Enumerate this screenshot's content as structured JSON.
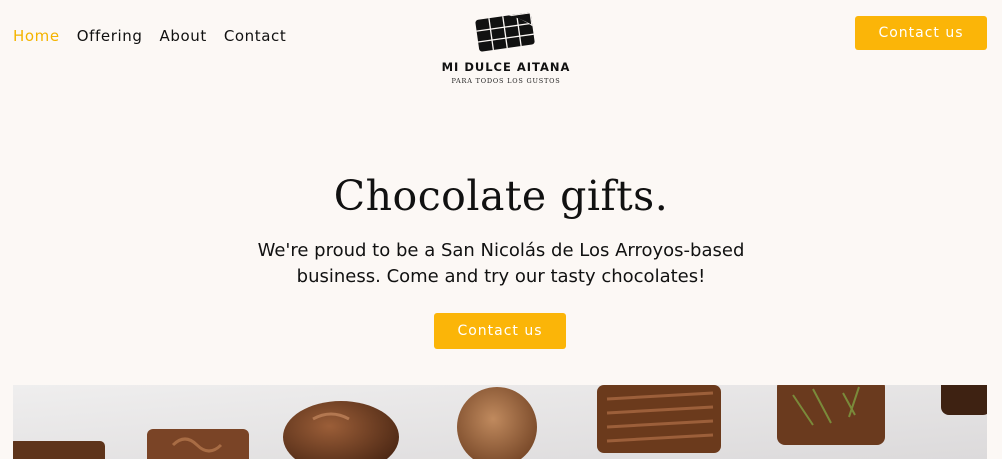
{
  "nav": {
    "items": [
      {
        "label": "Home",
        "active": true
      },
      {
        "label": "Offering",
        "active": false
      },
      {
        "label": "About",
        "active": false
      },
      {
        "label": "Contact",
        "active": false
      }
    ]
  },
  "logo": {
    "name": "MI DULCE AITANA",
    "tagline": "PARA TODOS LOS GUSTOS",
    "icon": "chocolate-bar-icon"
  },
  "header": {
    "cta_label": "Contact us"
  },
  "hero": {
    "title": "Chocolate gifts.",
    "subtitle": "We're proud to be a San Nicolás de Los Arroyos-based business. Come and try our tasty chocolates!",
    "cta_label": "Contact us"
  },
  "colors": {
    "accent": "#fbb508",
    "active_nav": "#f4b400",
    "background": "#fcf8f5"
  }
}
